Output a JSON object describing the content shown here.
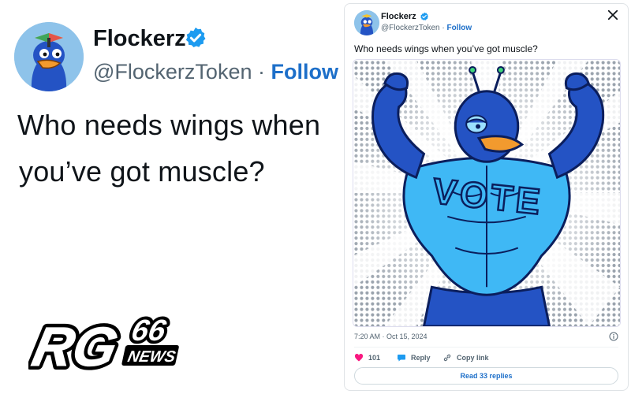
{
  "left_tweet": {
    "name": "Flockerz",
    "handle": "@FlockerzToken",
    "separator": "·",
    "follow_label": "Follow",
    "text_line1": "Who needs wings when",
    "text_line2": "you’ve got muscle?"
  },
  "card": {
    "name": "Flockerz",
    "handle": "@FlockerzToken",
    "separator": "·",
    "follow_label": "Follow",
    "text": "Who needs wings when you’ve got muscle?",
    "artwork_text": "VOTE",
    "timestamp": "7:20 AM · Oct 15, 2024",
    "likes": "101",
    "reply_label": "Reply",
    "copy_label": "Copy link",
    "read_replies_label": "Read 33 replies"
  },
  "logo": {
    "main": "RG",
    "number": "66",
    "sub": "NEWS"
  },
  "icons": {
    "verified": "verified-badge-icon",
    "x": "x-logo-icon",
    "info": "info-icon",
    "like": "heart-icon",
    "reply": "reply-bubble-icon",
    "copy": "link-icon"
  },
  "colors": {
    "accent": "#1d6fc9",
    "verified": "#1d9bf0",
    "heart": "#f91880",
    "bird_dark_blue": "#1f4fc8",
    "bird_light_blue": "#3fb8f5",
    "beak": "#f29a2e"
  }
}
